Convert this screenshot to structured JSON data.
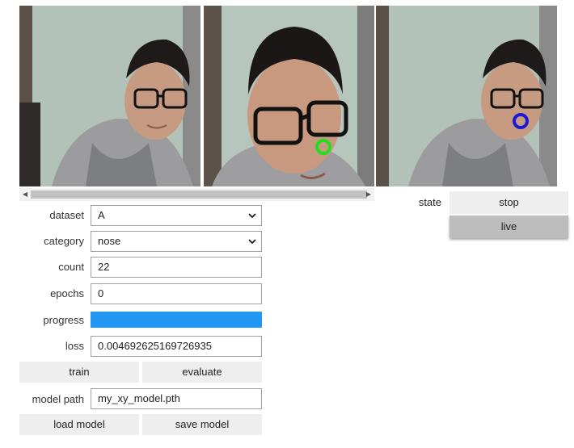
{
  "images": [
    {
      "name": "camera-frame-raw"
    },
    {
      "name": "camera-frame-target",
      "marker_color": "#22dd22"
    },
    {
      "name": "camera-frame-prediction",
      "marker_color": "#1a1ad6"
    }
  ],
  "form": {
    "dataset_label": "dataset",
    "dataset_value": "A",
    "category_label": "category",
    "category_value": "nose",
    "count_label": "count",
    "count_value": "22",
    "epochs_label": "epochs",
    "epochs_value": "0",
    "progress_label": "progress",
    "progress_fraction": 1.0,
    "progress_color": "#2196f3",
    "loss_label": "loss",
    "loss_value": "0.004692625169726935",
    "train_label": "train",
    "evaluate_label": "evaluate",
    "model_path_label": "model path",
    "model_path_value": "my_xy_model.pth",
    "load_model_label": "load model",
    "save_model_label": "save model"
  },
  "state": {
    "label": "state",
    "options": [
      "stop",
      "live"
    ],
    "selected": "live"
  }
}
